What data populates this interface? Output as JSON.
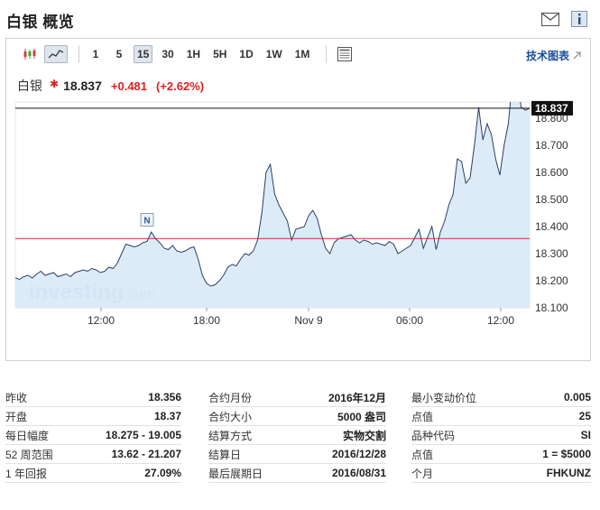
{
  "header": {
    "title": "白银 概览"
  },
  "toolbar": {
    "timeframes": [
      "1",
      "5",
      "15",
      "30",
      "1H",
      "5H",
      "1D",
      "1W",
      "1M"
    ],
    "active_timeframe": "15",
    "tech_chart_label": "技术图表"
  },
  "quote": {
    "name": "白银",
    "price": "18.837",
    "change": "+0.481",
    "change_pct": "(+2.62%)"
  },
  "colors": {
    "up": "#e02020",
    "line": "#2c3e66",
    "fill": "#d7e8f8",
    "prev_close_line": "#c83030",
    "link": "#1a4f9c"
  },
  "chart_data": {
    "type": "area",
    "watermark": "investing.com",
    "x_tick_labels": [
      "12:00",
      "18:00",
      "Nov 9",
      "06:00",
      "12:00"
    ],
    "y_tick_labels": [
      "18.100",
      "18.200",
      "18.300",
      "18.400",
      "18.500",
      "18.600",
      "18.700",
      "18.800"
    ],
    "ylim": [
      18.1,
      18.86
    ],
    "last_price_label": "18.837",
    "last_price": 18.837,
    "prev_close": 18.356,
    "annotation": "N",
    "annotation_index": 31,
    "values": [
      18.21,
      18.205,
      18.215,
      18.22,
      18.21,
      18.225,
      18.235,
      18.22,
      18.225,
      18.23,
      18.215,
      18.22,
      18.225,
      18.215,
      18.23,
      18.235,
      18.24,
      18.235,
      18.245,
      18.24,
      18.23,
      18.235,
      18.25,
      18.245,
      18.265,
      18.3,
      18.335,
      18.33,
      18.325,
      18.33,
      18.34,
      18.345,
      18.38,
      18.355,
      18.34,
      18.32,
      18.315,
      18.33,
      18.31,
      18.305,
      18.31,
      18.32,
      18.325,
      18.28,
      18.22,
      18.19,
      18.18,
      18.185,
      18.2,
      18.22,
      18.25,
      18.26,
      18.255,
      18.28,
      18.3,
      18.295,
      18.31,
      18.35,
      18.45,
      18.6,
      18.63,
      18.52,
      18.48,
      18.45,
      18.42,
      18.35,
      18.39,
      18.395,
      18.4,
      18.44,
      18.46,
      18.43,
      18.37,
      18.32,
      18.3,
      18.34,
      18.355,
      18.36,
      18.365,
      18.37,
      18.35,
      18.34,
      18.35,
      18.345,
      18.335,
      18.34,
      18.335,
      18.33,
      18.345,
      18.335,
      18.3,
      18.31,
      18.32,
      18.33,
      18.36,
      18.39,
      18.32,
      18.36,
      18.4,
      18.315,
      18.38,
      18.42,
      18.48,
      18.52,
      18.65,
      18.64,
      18.56,
      18.58,
      18.7,
      18.84,
      18.72,
      18.78,
      18.74,
      18.65,
      18.59,
      18.7,
      18.78,
      18.95,
      18.955,
      18.84,
      18.83,
      18.837
    ]
  },
  "stats": {
    "col1": [
      {
        "label": "昨收",
        "value": "18.356"
      },
      {
        "label": "开盘",
        "value": "18.37"
      },
      {
        "label": "每日幅度",
        "value": "18.275 - 19.005"
      },
      {
        "label": "52 周范围",
        "value": "13.62 - 21.207"
      },
      {
        "label": "1 年回报",
        "value": "27.09%"
      }
    ],
    "col2": [
      {
        "label": "合约月份",
        "value": "2016年12月"
      },
      {
        "label": "合约大小",
        "value": "5000 盎司"
      },
      {
        "label": "结算方式",
        "value": "实物交割"
      },
      {
        "label": "结算日",
        "value": "2016/12/28"
      },
      {
        "label": "最后展期日",
        "value": "2016/08/31"
      }
    ],
    "col3": [
      {
        "label": "最小变动价位",
        "value": "0.005"
      },
      {
        "label": "点值",
        "value": "25"
      },
      {
        "label": "品种代码",
        "value": "SI"
      },
      {
        "label": "点值",
        "value": "1 = $5000"
      },
      {
        "label": "个月",
        "value": "FHKUNZ"
      }
    ]
  }
}
